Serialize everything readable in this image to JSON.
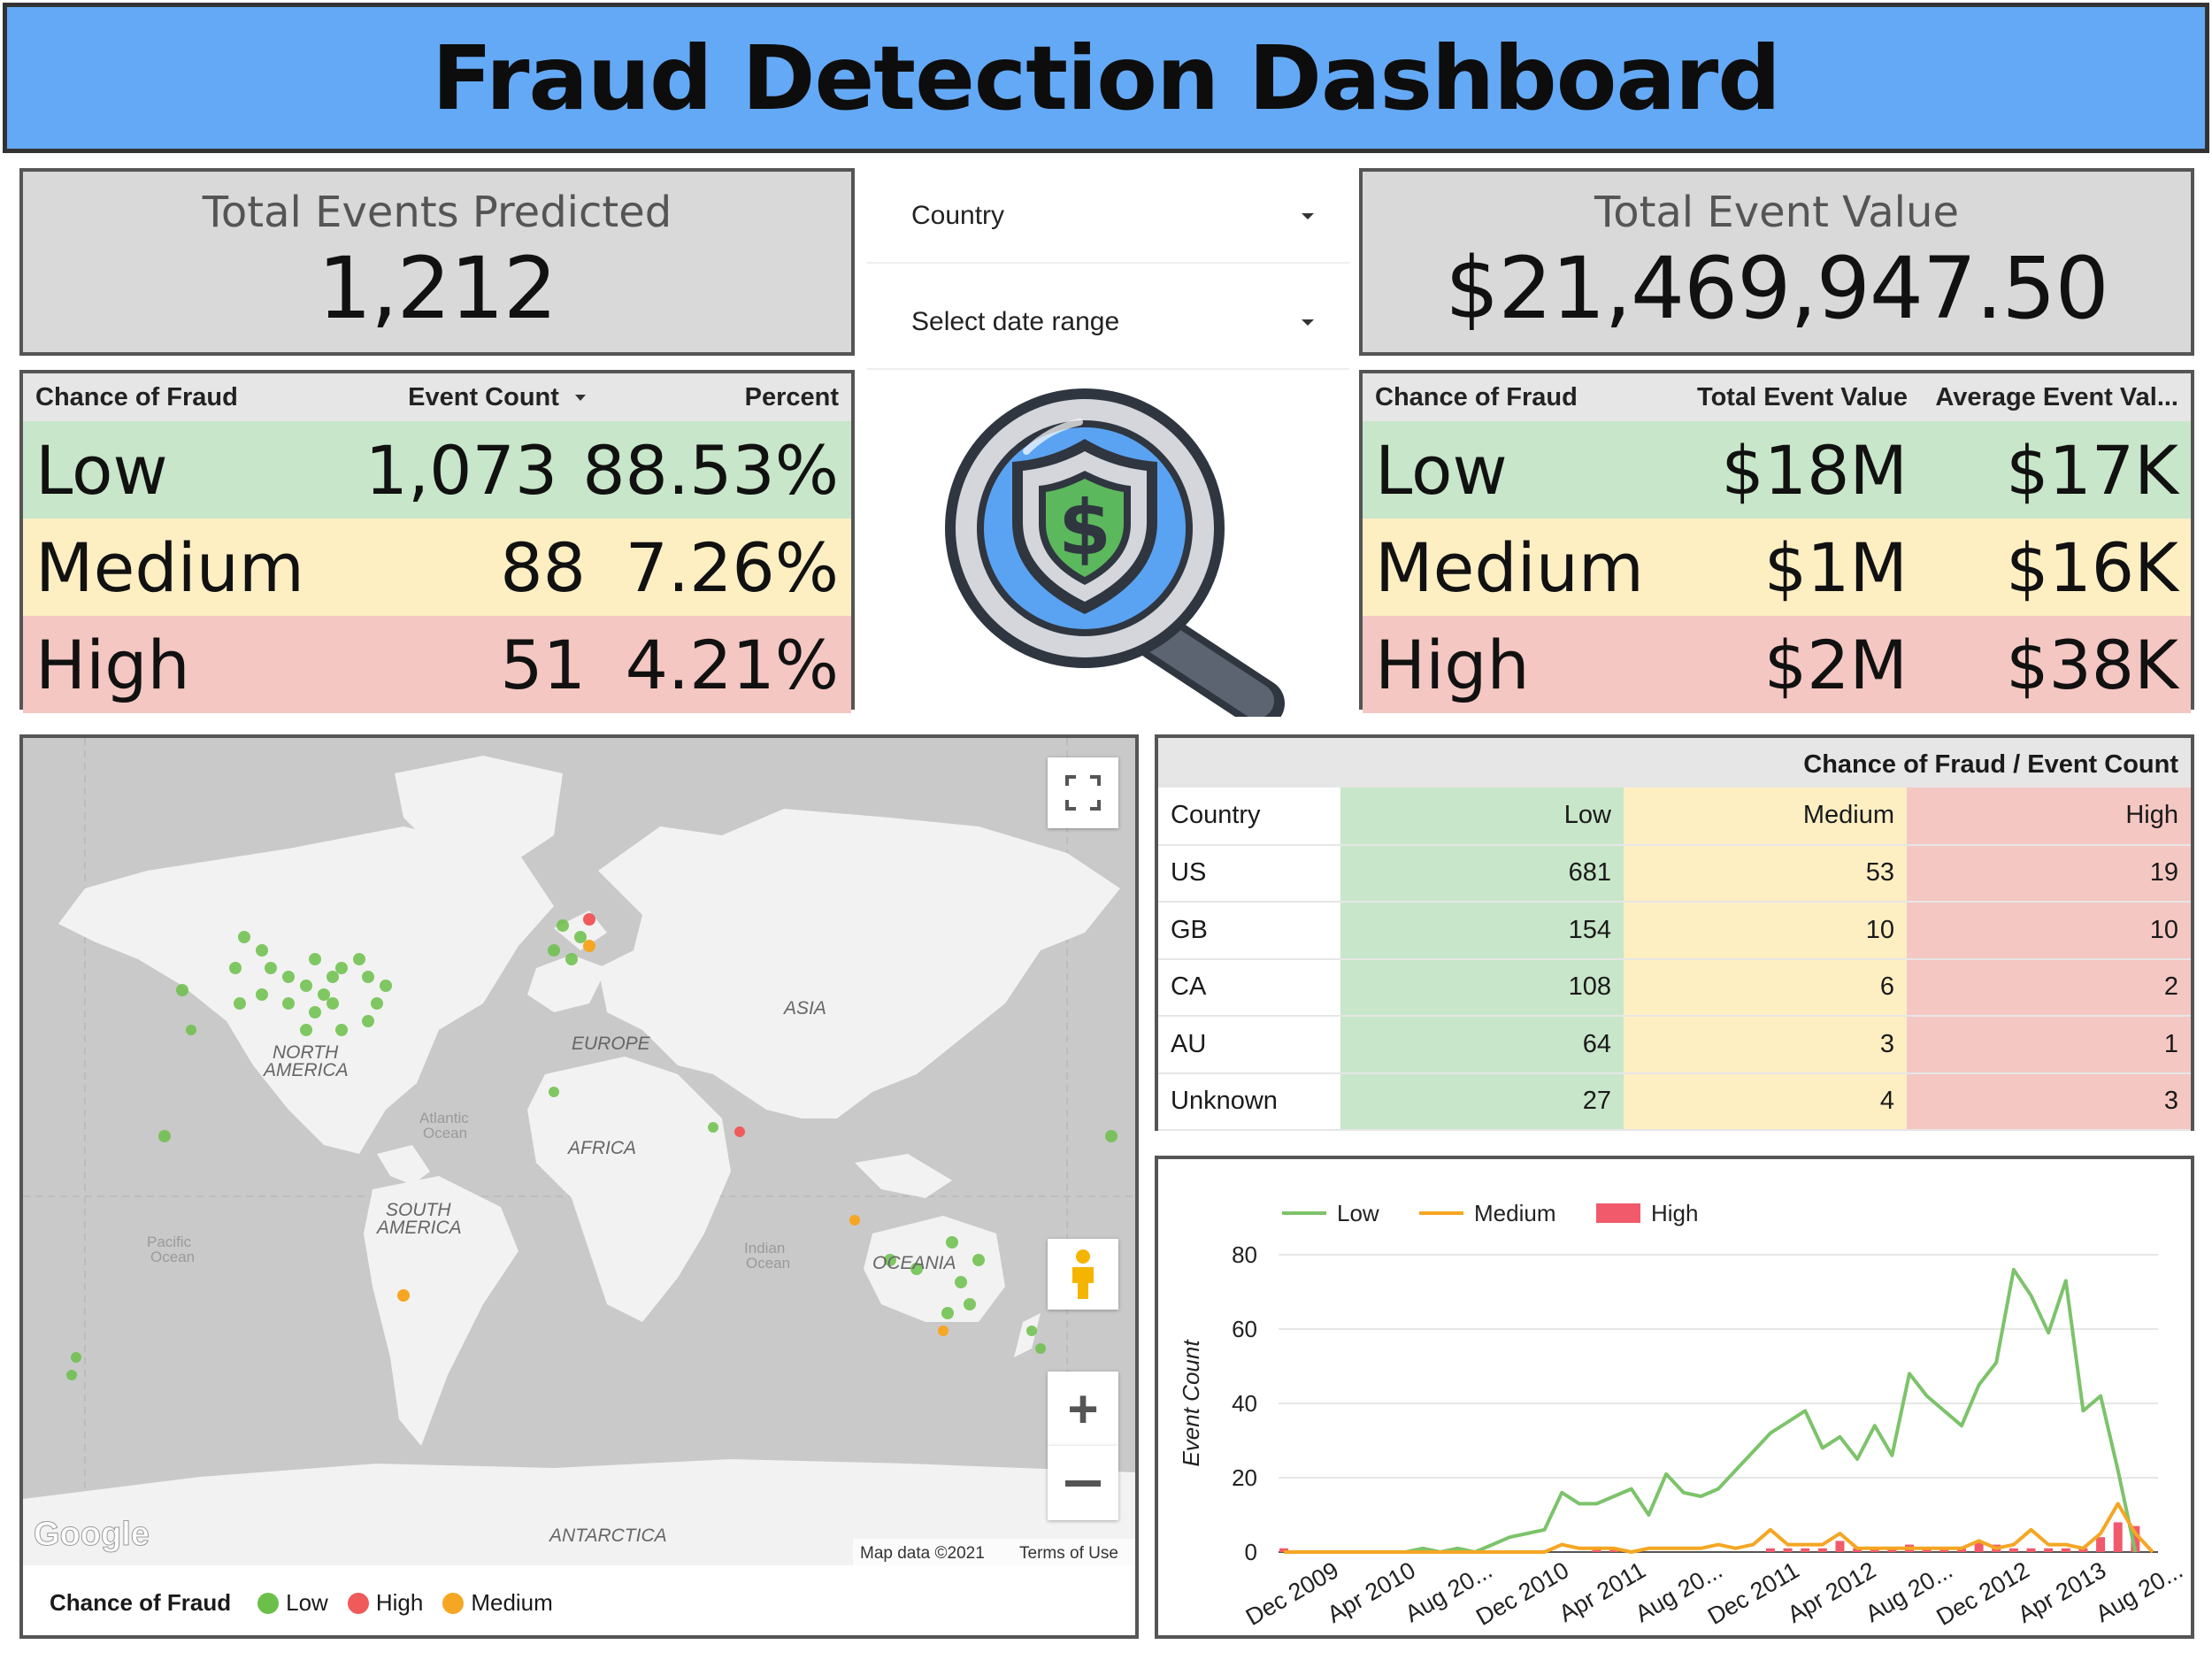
{
  "header": {
    "title": "Fraud Detection Dashboard"
  },
  "scorecards": {
    "events": {
      "label": "Total Events Predicted",
      "value": "1,212"
    },
    "value": {
      "label": "Total Event Value",
      "value": "$21,469,947.50"
    }
  },
  "filters": {
    "country": {
      "label": "Country"
    },
    "date": {
      "label": "Select date range"
    }
  },
  "count_table": {
    "headers": {
      "chance": "Chance of Fraud",
      "count": "Event Count",
      "percent": "Percent"
    },
    "rows": [
      {
        "level": "Low",
        "count": "1,073",
        "percent": "88.53%"
      },
      {
        "level": "Medium",
        "count": "88",
        "percent": "7.26%"
      },
      {
        "level": "High",
        "count": "51",
        "percent": "4.21%"
      }
    ]
  },
  "value_table": {
    "headers": {
      "chance": "Chance of Fraud",
      "total": "Total Event Value",
      "average": "Average Event Val..."
    },
    "rows": [
      {
        "level": "Low",
        "total": "$18M",
        "average": "$17K"
      },
      {
        "level": "Medium",
        "total": "$1M",
        "average": "$16K"
      },
      {
        "level": "High",
        "total": "$2M",
        "average": "$38K"
      }
    ]
  },
  "map": {
    "labels": {
      "north_america_1": "NORTH",
      "north_america_2": "AMERICA",
      "south_america_1": "SOUTH",
      "south_america_2": "AMERICA",
      "europe": "EUROPE",
      "asia": "ASIA",
      "africa": "AFRICA",
      "oceania": "OCEANIA",
      "antarctica": "ANTARCTICA",
      "atlantic_1": "Atlantic",
      "atlantic_2": "Ocean",
      "pacific_1": "Pacific",
      "pacific_2": "Ocean",
      "indian_1": "Indian",
      "indian_2": "Ocean"
    },
    "google": "Google",
    "map_data": "Map data ©2021",
    "terms": "Terms of Use",
    "legend": {
      "title": "Chance of Fraud",
      "items": [
        {
          "label": "Low",
          "color": "#6cc04a"
        },
        {
          "label": "High",
          "color": "#f05a5a"
        },
        {
          "label": "Medium",
          "color": "#f5a623"
        }
      ]
    }
  },
  "country_table": {
    "title": "Chance of Fraud / Event Count",
    "headers": {
      "country": "Country",
      "low": "Low",
      "medium": "Medium",
      "high": "High"
    },
    "rows": [
      {
        "country": "US",
        "low": "681",
        "medium": "53",
        "high": "19"
      },
      {
        "country": "GB",
        "low": "154",
        "medium": "10",
        "high": "10"
      },
      {
        "country": "CA",
        "low": "108",
        "medium": "6",
        "high": "2"
      },
      {
        "country": "AU",
        "low": "64",
        "medium": "3",
        "high": "1"
      },
      {
        "country": "Unknown",
        "low": "27",
        "medium": "4",
        "high": "3"
      }
    ]
  },
  "chart_data": {
    "type": "line",
    "title": "",
    "xlabel": "",
    "ylabel": "Event Count",
    "ylim": [
      0,
      80
    ],
    "yticks": [
      0,
      20,
      40,
      60,
      80
    ],
    "tick_labels": [
      "Dec 2009",
      "Apr 2010",
      "Aug 20...",
      "Dec 2010",
      "Apr 2011",
      "Aug 20...",
      "Dec 2011",
      "Apr 2012",
      "Aug 20...",
      "Dec 2012",
      "Apr 2013",
      "Aug 20..."
    ],
    "legend_position": "top-left",
    "series": [
      {
        "name": "Low",
        "kind": "line",
        "color": "#7cc36a",
        "values": [
          0,
          0,
          0,
          0,
          0,
          0,
          0,
          0,
          1,
          0,
          1,
          0,
          2,
          4,
          5,
          6,
          16,
          13,
          13,
          15,
          17,
          10,
          21,
          16,
          15,
          17,
          22,
          27,
          32,
          35,
          38,
          28,
          31,
          25,
          34,
          26,
          48,
          42,
          38,
          34,
          45,
          51,
          76,
          69,
          59,
          73,
          38,
          42,
          22,
          0
        ]
      },
      {
        "name": "Medium",
        "kind": "line",
        "color": "#f5a623",
        "values": [
          0,
          0,
          0,
          0,
          0,
          0,
          0,
          0,
          0,
          0,
          0,
          0,
          0,
          0,
          0,
          0,
          2,
          1,
          1,
          1,
          0,
          1,
          1,
          1,
          1,
          2,
          1,
          2,
          6,
          2,
          2,
          2,
          5,
          1,
          1,
          1,
          1,
          1,
          1,
          1,
          3,
          1,
          2,
          6,
          2,
          2,
          1,
          5,
          13,
          5,
          0
        ]
      },
      {
        "name": "High",
        "kind": "bar",
        "color": "#f05a6a",
        "values": [
          1,
          0,
          0,
          0,
          0,
          0,
          0,
          0,
          0,
          0,
          0,
          0,
          0,
          0,
          0,
          0,
          0,
          0,
          1,
          1,
          0,
          0,
          0,
          0,
          0,
          0,
          0,
          0,
          1,
          1,
          1,
          1,
          3,
          1,
          1,
          1,
          2,
          1,
          1,
          1,
          3,
          2,
          1,
          1,
          1,
          1,
          1,
          4,
          8,
          7
        ]
      }
    ]
  }
}
